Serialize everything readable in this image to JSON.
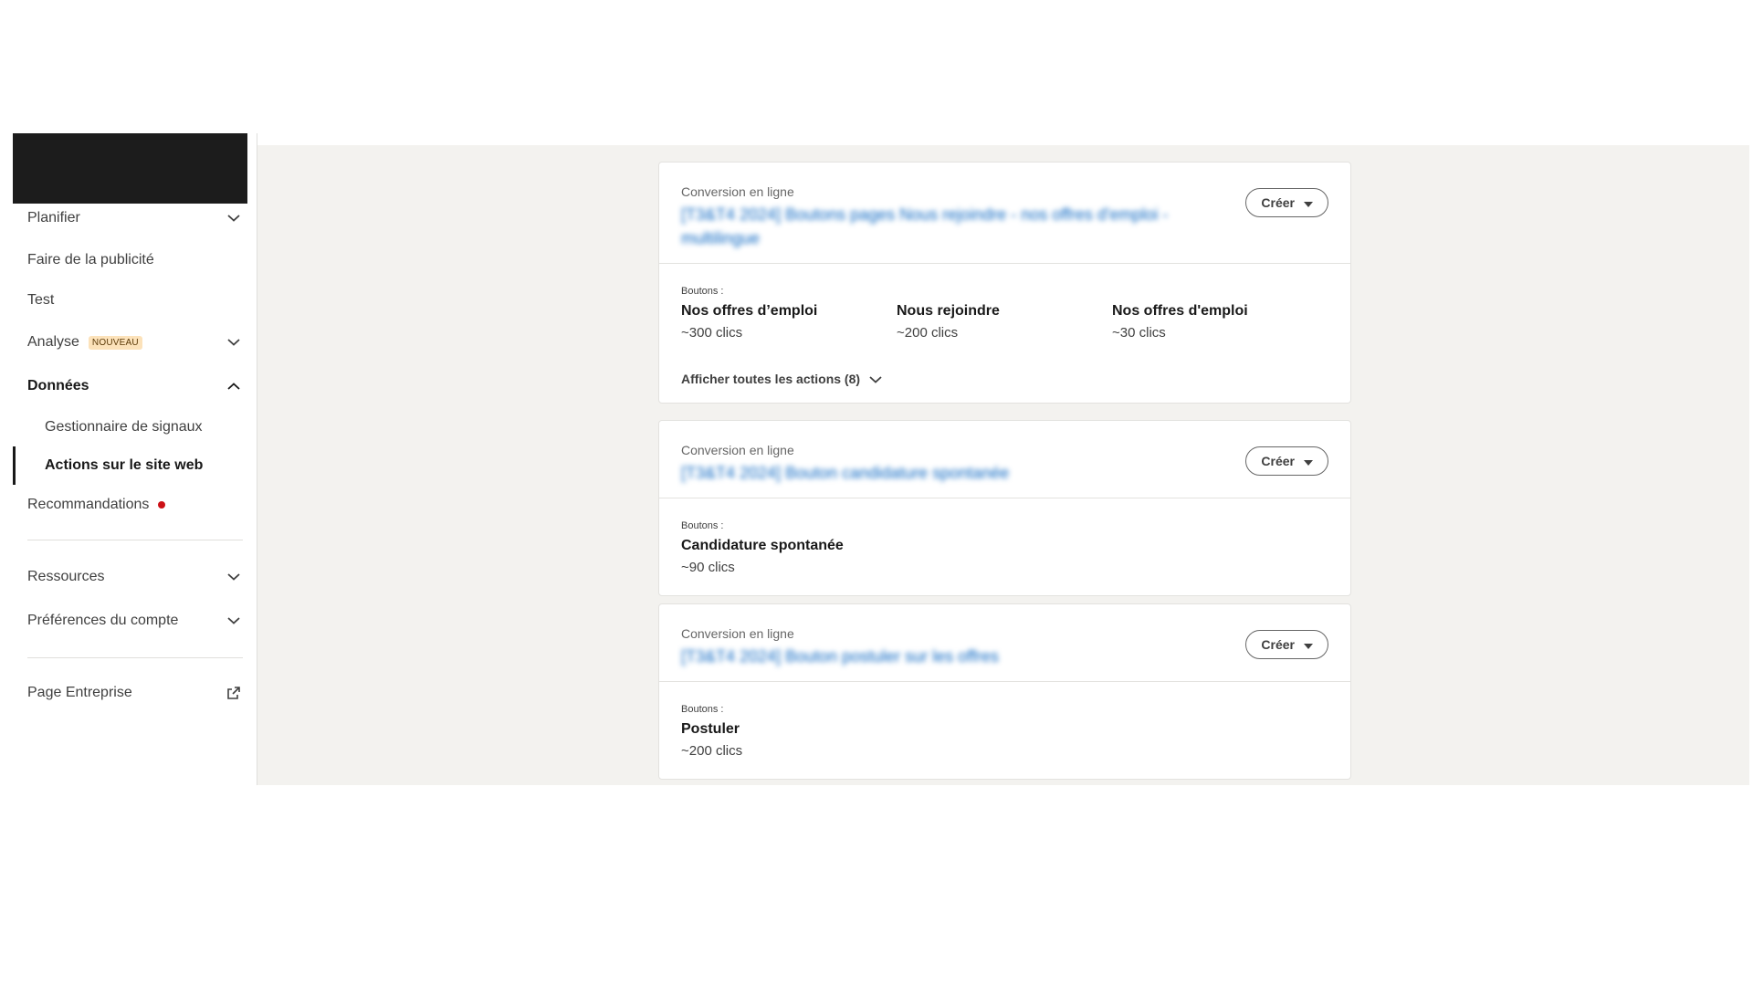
{
  "sidebar": {
    "items": [
      {
        "label": "Planifier"
      },
      {
        "label": "Faire de la publicité"
      },
      {
        "label": "Test"
      },
      {
        "label": "Analyse",
        "badge": "NOUVEAU"
      },
      {
        "label": "Données"
      },
      {
        "label": "Gestionnaire de signaux"
      },
      {
        "label": "Actions sur le site web"
      },
      {
        "label": "Recommandations"
      },
      {
        "label": "Ressources"
      },
      {
        "label": "Préférences du compte"
      },
      {
        "label": "Page Entreprise"
      }
    ]
  },
  "cards": [
    {
      "type": "Conversion en ligne",
      "title": "[T3&T4 2024] Boutons pages Nous rejoindre - nos offres d'emploi - multilingue",
      "button": "Créer",
      "section_label": "Boutons :",
      "metrics": [
        {
          "name": "Nos offres d’emploi",
          "value": "~300 clics"
        },
        {
          "name": "Nous rejoindre",
          "value": "~200 clics"
        },
        {
          "name": "Nos offres d'emploi",
          "value": "~30 clics"
        }
      ],
      "show_all": "Afficher toutes les actions (8)"
    },
    {
      "type": "Conversion en ligne",
      "title": "[T3&T4 2024] Bouton candidature spontanée",
      "button": "Créer",
      "section_label": "Boutons :",
      "metrics": [
        {
          "name": "Candidature spontanée",
          "value": "~90 clics"
        }
      ]
    },
    {
      "type": "Conversion en ligne",
      "title": "[T3&T4 2024] Bouton postuler sur les offres",
      "button": "Créer",
      "section_label": "Boutons :",
      "metrics": [
        {
          "name": "Postuler",
          "value": "~200 clics"
        }
      ]
    }
  ],
  "colors": {
    "accent": "#0a66c2",
    "background": "#f3f2ef",
    "notification": "#cc1016"
  }
}
